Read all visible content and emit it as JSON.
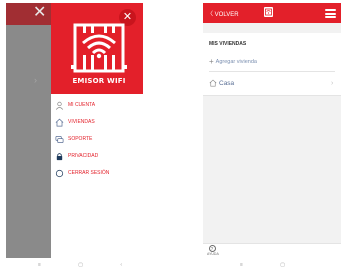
{
  "left_screen": {
    "overlay_close_glyph": "✕",
    "drawer": {
      "close_glyph": "✕",
      "logo_text": "EMISOR WIFI",
      "menu": [
        {
          "label": "MI CUENTA",
          "icon": "user-icon"
        },
        {
          "label": "VIVIENDAS",
          "icon": "house-icon"
        },
        {
          "label": "SOPORTE",
          "icon": "chat-icon"
        },
        {
          "label": "PRIVACIDAD",
          "icon": "lock-icon"
        },
        {
          "label": "CERRAR SESIÓN",
          "icon": "logout-icon"
        }
      ]
    },
    "nav_bar": "≡ ▢ ‹"
  },
  "right_screen": {
    "topbar": {
      "back_label": "〈 VOLVER",
      "menu_icon": "hamburger-icon"
    },
    "section_title": "MIS VIVIENDAS",
    "add_label": "Agregar vivienda",
    "add_glyph": "+",
    "homes": [
      {
        "name": "Casa",
        "icon": "house-icon"
      }
    ],
    "help_label": "AYUDA",
    "help_glyph": "?",
    "nav_bar": "≡ ▢ ‹"
  },
  "colors": {
    "brand_red": "#e3202a",
    "dark_red": "#a12e33",
    "link_blue": "#5a6f95"
  }
}
